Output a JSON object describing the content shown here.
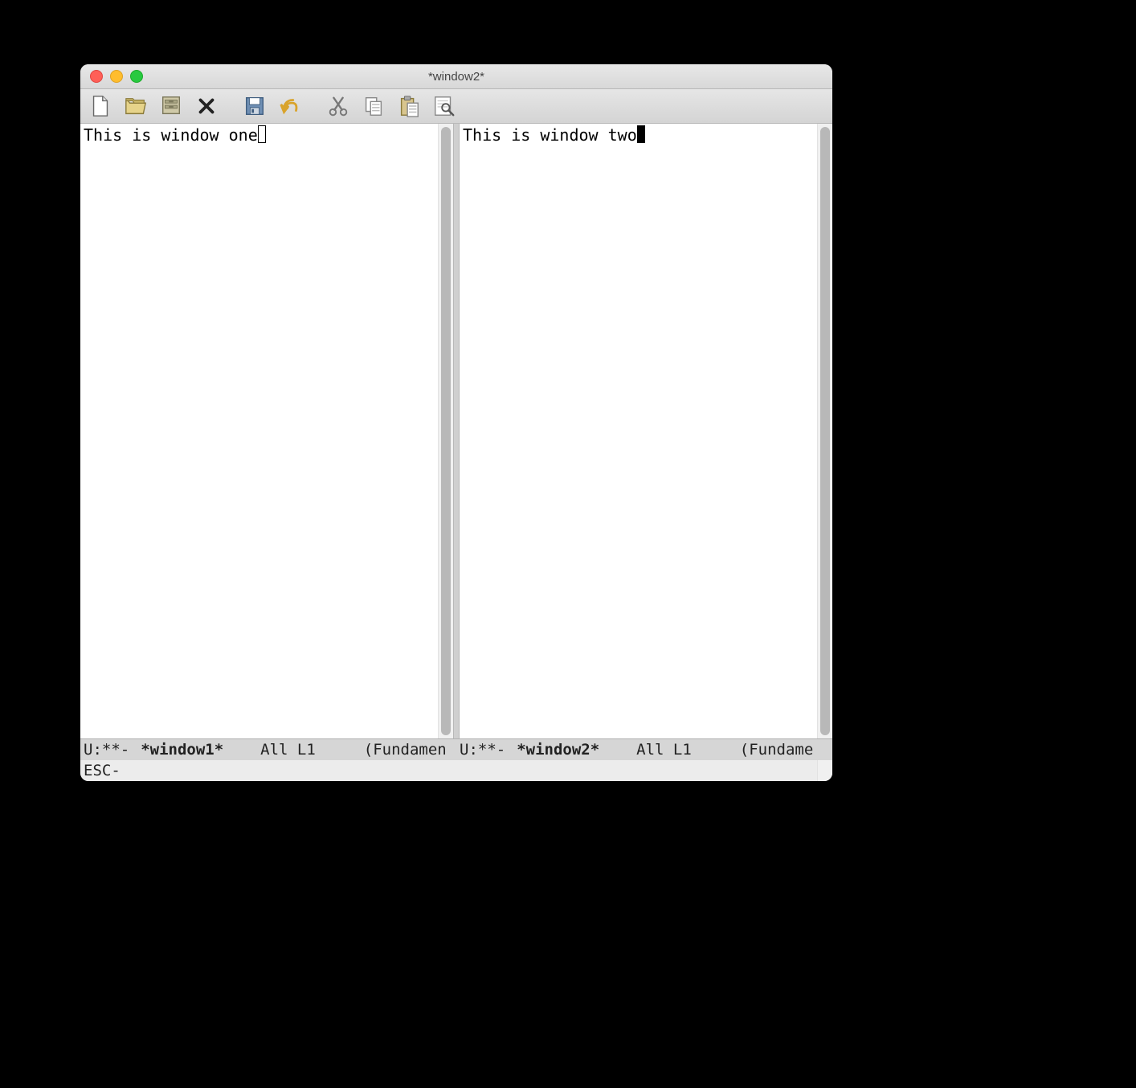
{
  "window": {
    "title": "*window2*"
  },
  "toolbar": {
    "icons": [
      "new-file",
      "open-file",
      "dired",
      "close",
      "save",
      "undo",
      "cut",
      "copy",
      "paste",
      "search"
    ]
  },
  "panes": {
    "left": {
      "content": "This is window one",
      "cursor": "hollow",
      "modeline": {
        "status": "U:**-",
        "buffer_name": "*window1*",
        "position": "All L1",
        "mode": "(Fundamen"
      }
    },
    "right": {
      "content": "This is window two",
      "cursor": "solid",
      "modeline": {
        "status": "U:**-",
        "buffer_name": "*window2*",
        "position": "All L1",
        "mode": "(Fundame"
      }
    }
  },
  "minibuffer": {
    "text": "ESC-"
  }
}
